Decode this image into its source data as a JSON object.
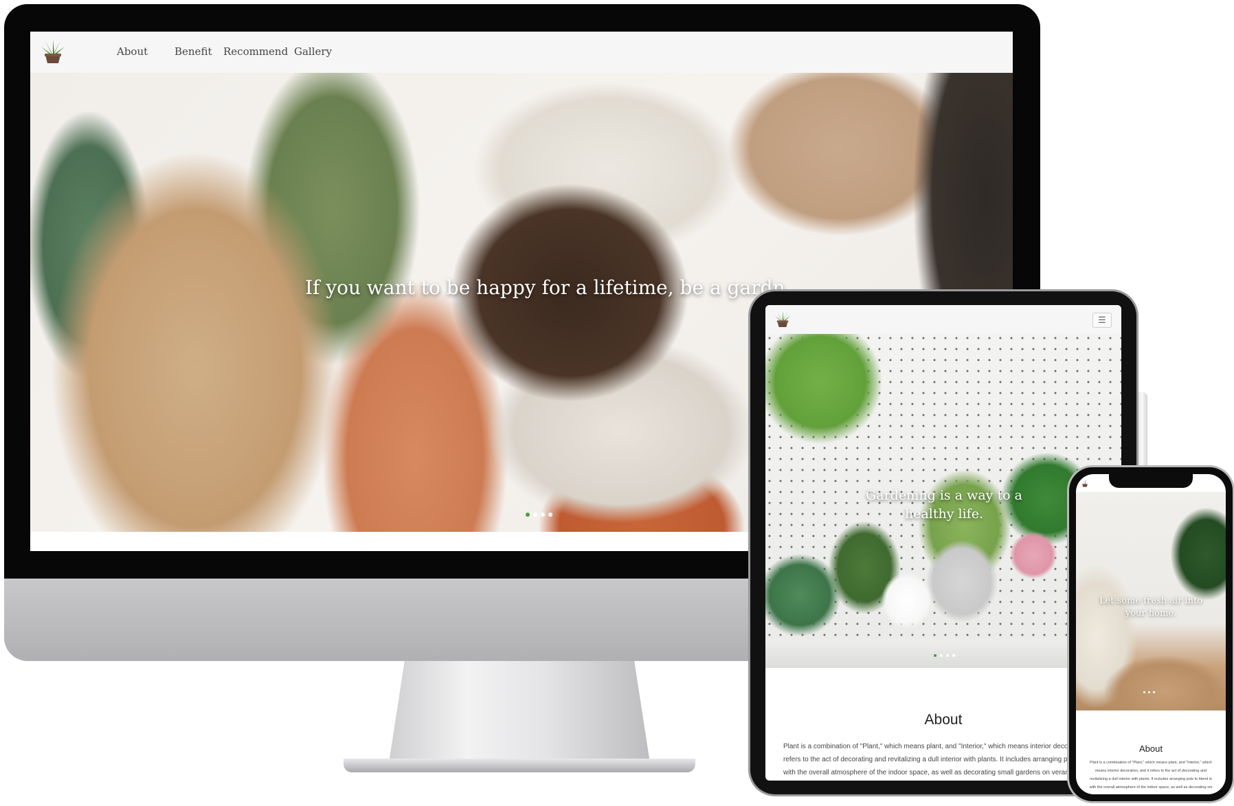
{
  "desktop": {
    "nav": {
      "logo_icon": "potted-plant-icon",
      "links": [
        "About",
        "Benefit",
        "Recommend",
        "Gallery"
      ]
    },
    "hero": {
      "text": "If you want to be happy for a lifetime, be a gardn",
      "active_slide": 1,
      "slide_count": 4
    }
  },
  "tablet": {
    "nav": {
      "logo_icon": "potted-plant-icon",
      "menu_icon": "hamburger-menu-icon"
    },
    "hero": {
      "text": "Gardening is a way to a healthy life.",
      "active_slide": 1,
      "slide_count": 4
    },
    "about": {
      "title": "About",
      "lines": [
        "Plant is a combination of \"Plant,\" which means plant, and \"Interior,\" which means interior decoratio",
        "refers to the act of decorating and revitalizing a dull interior with plants. It includes arranging pots t",
        "with the overall atmosphere of the indoor space, as well as decorating small gardens on verandas or"
      ]
    }
  },
  "phone": {
    "nav": {
      "logo_icon": "potted-plant-icon"
    },
    "hero": {
      "text": "Let some fresh air into your home.",
      "slide_count": 3
    },
    "about": {
      "title": "About",
      "lines": [
        "Plant is a combination of \"Plant,\" which means plant, and \"Interior,\" which",
        "means interior decoration, and it refers to the act of decorating and",
        "revitalizing a dull interior with plants. It includes arranging pots to blend in",
        "with the overall atmosphere of the indoor space, as well as decorating sm"
      ]
    }
  },
  "colors": {
    "accent_green": "#4a9d3f",
    "nav_bg": "#f6f6f6",
    "device_black": "#070707",
    "imac_silver": "#c0c0c2"
  }
}
